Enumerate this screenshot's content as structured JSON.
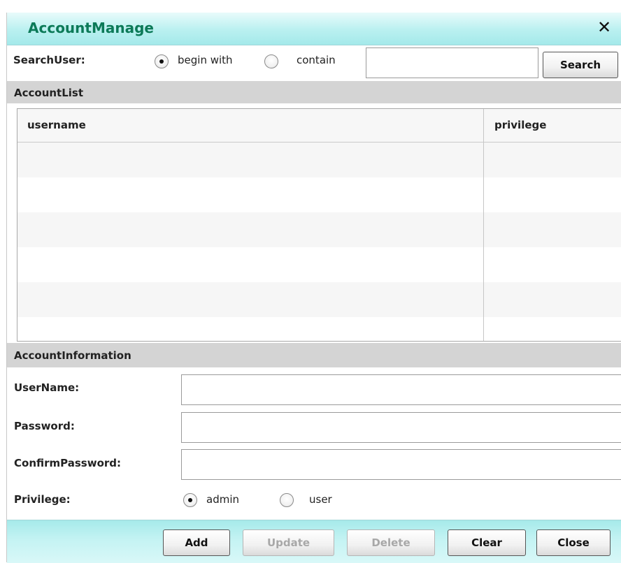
{
  "window": {
    "title": "AccountManage",
    "close_icon": "close-icon"
  },
  "search": {
    "label": "SearchUser:",
    "options": [
      {
        "label": "begin with",
        "checked": true
      },
      {
        "label": "contain",
        "checked": false
      }
    ],
    "input_value": "",
    "button_label": "Search"
  },
  "account_list": {
    "header": "AccountList",
    "columns": [
      "username",
      "privilege"
    ],
    "rows": []
  },
  "account_info": {
    "header": "AccountInformation",
    "fields": [
      {
        "label": "UserName:",
        "value": ""
      },
      {
        "label": "Password:",
        "value": ""
      },
      {
        "label": "ConfirmPassword:",
        "value": ""
      }
    ],
    "privilege": {
      "label": "Privilege:",
      "options": [
        {
          "label": "admin",
          "checked": true
        },
        {
          "label": "user",
          "checked": false
        }
      ]
    }
  },
  "footer": {
    "buttons": [
      {
        "label": "Add",
        "enabled": true
      },
      {
        "label": "Update",
        "enabled": false
      },
      {
        "label": "Delete",
        "enabled": false
      },
      {
        "label": "Clear",
        "enabled": true
      },
      {
        "label": "Close",
        "enabled": true
      }
    ]
  },
  "colors": {
    "title_text": "#0c7a58",
    "titlebar_bg": "#b9f0f0",
    "section_bg": "#d4d4d4",
    "disabled_text": "#a8a8a8"
  }
}
